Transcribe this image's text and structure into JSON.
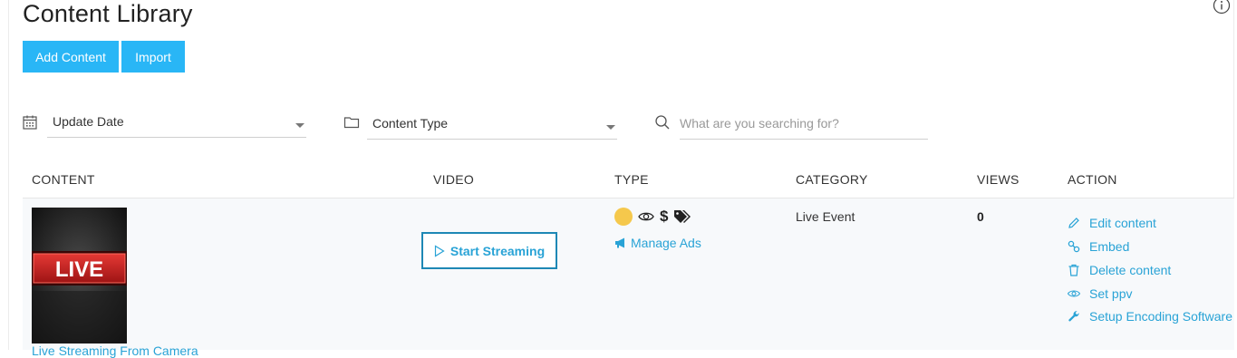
{
  "page": {
    "title": "Content Library"
  },
  "toolbar": {
    "add_label": "Add Content",
    "import_label": "Import"
  },
  "filters": {
    "date": {
      "value": "Update Date"
    },
    "type": {
      "value": "Content Type"
    },
    "search": {
      "placeholder": "What are you searching for?"
    }
  },
  "table": {
    "headers": [
      "CONTENT",
      "VIDEO",
      "TYPE",
      "CATEGORY",
      "VIEWS",
      "ACTION"
    ],
    "rows": [
      {
        "thumbnail_text": "LIVE",
        "title": "Live Streaming From Camera",
        "video_button": "Start Streaming",
        "type_icons": [
          "status-dot",
          "eye-icon",
          "dollar-icon",
          "tags-icon"
        ],
        "status_color": "#f5c84c",
        "manage_ads": "Manage Ads",
        "category": "Live Event",
        "views": "0",
        "actions": [
          {
            "label": "Edit content",
            "icon": "pencil-icon"
          },
          {
            "label": "Embed",
            "icon": "link-icon"
          },
          {
            "label": "Delete content",
            "icon": "trash-icon"
          },
          {
            "label": "Set ppv",
            "icon": "eye-icon"
          },
          {
            "label": "Setup Encoding Software",
            "icon": "wrench-icon"
          }
        ]
      }
    ]
  },
  "colors": {
    "accent": "#29b6f6",
    "link": "#29a3d6",
    "border_focus": "#1e88b5"
  }
}
